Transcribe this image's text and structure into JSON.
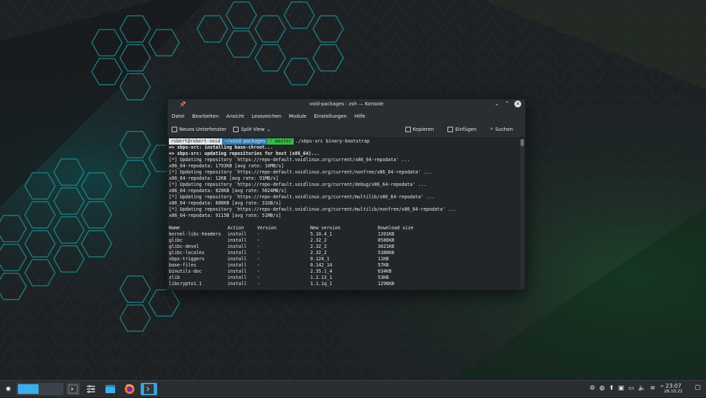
{
  "window": {
    "title": "void-packages : zsh — Konsole",
    "menu": [
      "Datei",
      "Bearbeiten",
      "Ansicht",
      "Lesezeichen",
      "Module",
      "Einstellungen",
      "Hilfe"
    ],
    "toolbar": {
      "new_tab": "Neues Unterfenster",
      "split_view": "Split View",
      "copy": "Kopieren",
      "paste": "Einfügen",
      "search": "Suchen"
    }
  },
  "terminal": {
    "prompt": {
      "user": "robert@robert-void",
      "path": "~/void-packages",
      "git": "master",
      "command": "./xbps-src binary-bootstrap"
    },
    "lines": [
      {
        "text": "=> xbps-src: installing base-chroot...",
        "bold": true
      },
      {
        "text": "=> xbps-src: updating repositories for host (x86_64)...",
        "bold": true
      },
      {
        "text": "[*] Updating repository `https://repo-default.voidlinux.org/current/x86_64-repodata' ...",
        "bold": false
      },
      {
        "text": "x86_64-repodata: 1793KB [avg rate: 10MB/s]",
        "bold": false
      },
      {
        "text": "[*] Updating repository `https://repo-default.voidlinux.org/current/nonfree/x86_64-repodata' ...",
        "bold": false
      },
      {
        "text": "x86_64-repodata: 12KB [avg rate: 91MB/s]",
        "bold": false
      },
      {
        "text": "[*] Updating repository `https://repo-default.voidlinux.org/current/debug/x86_64-repodata' ...",
        "bold": false
      },
      {
        "text": "x86_64-repodata: 820KB [avg rate: 5024MB/s]",
        "bold": false
      },
      {
        "text": "[*] Updating repository `https://repo-default.voidlinux.org/current/multilib/x86_64-repodata' ...",
        "bold": false
      },
      {
        "text": "x86_64-repodata: 688KB [avg rate: 31GB/s]",
        "bold": false
      },
      {
        "text": "[*] Updating repository `https://repo-default.voidlinux.org/current/multilib/nonfree/x86_64-repodata' ...",
        "bold": false
      },
      {
        "text": "x86_64-repodata: 9115B [avg rate: 51MB/s]",
        "bold": false
      },
      {
        "text": "",
        "bold": false
      }
    ],
    "table": {
      "headers": [
        "Name",
        "Action",
        "Version",
        "New version",
        "Download size"
      ],
      "rows": [
        [
          "kernel-libc-headers",
          "install",
          "-",
          "5.10.4_1",
          "1201KB"
        ],
        [
          "glibc",
          "install",
          "-",
          "2.32_2",
          "8586KB"
        ],
        [
          "glibc-devel",
          "install",
          "-",
          "2.32_2",
          "3021KB"
        ],
        [
          "glibc-locales",
          "install",
          "-",
          "2.32_2",
          "5380KB"
        ],
        [
          "xbps-triggers",
          "install",
          "-",
          "0.124_1",
          "11KB"
        ],
        [
          "base-files",
          "install",
          "-",
          "0.142_14",
          "57KB"
        ],
        [
          "binutils-doc",
          "install",
          "-",
          "2.35.1_4",
          "634KB"
        ],
        [
          "zlib",
          "install",
          "-",
          "1.2.13_1",
          "53KB"
        ],
        [
          "libcrypto1.1",
          "install",
          "-",
          "1.1.1q_1",
          "1296KB"
        ]
      ]
    }
  },
  "taskbar": {
    "time": "23:07",
    "date": "28.10.22",
    "launcher_icon": "kde-launcher-icon",
    "tray_icons": [
      "notifications-icon",
      "media-icon",
      "updates-icon",
      "clipboard-icon",
      "battery-icon",
      "volume-icon",
      "network-icon",
      "tray-expand-icon"
    ]
  },
  "colors": {
    "accent": "#3daee9",
    "path_segment": "#2f7fb8",
    "git_segment": "#2ebf47",
    "window_bg": "#232629"
  }
}
